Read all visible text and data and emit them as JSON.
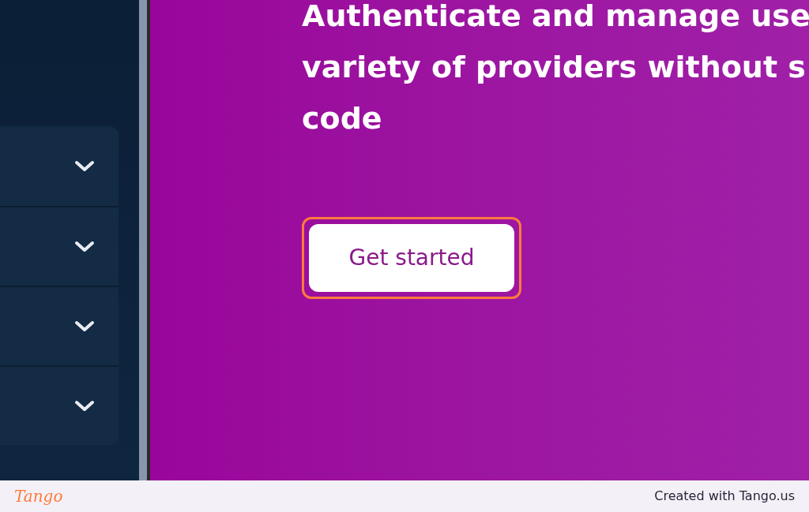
{
  "sidebar": {
    "accordion": [
      {
        "expanded": false
      },
      {
        "expanded": false
      },
      {
        "expanded": false
      },
      {
        "expanded": false
      }
    ]
  },
  "hero": {
    "lines": [
      "Authenticate and manage use",
      "variety of providers without s",
      "code"
    ],
    "button": {
      "label": "Get started",
      "highlighted": true
    }
  },
  "footer": {
    "logo": "Tango",
    "credit": "Created with Tango.us"
  }
}
